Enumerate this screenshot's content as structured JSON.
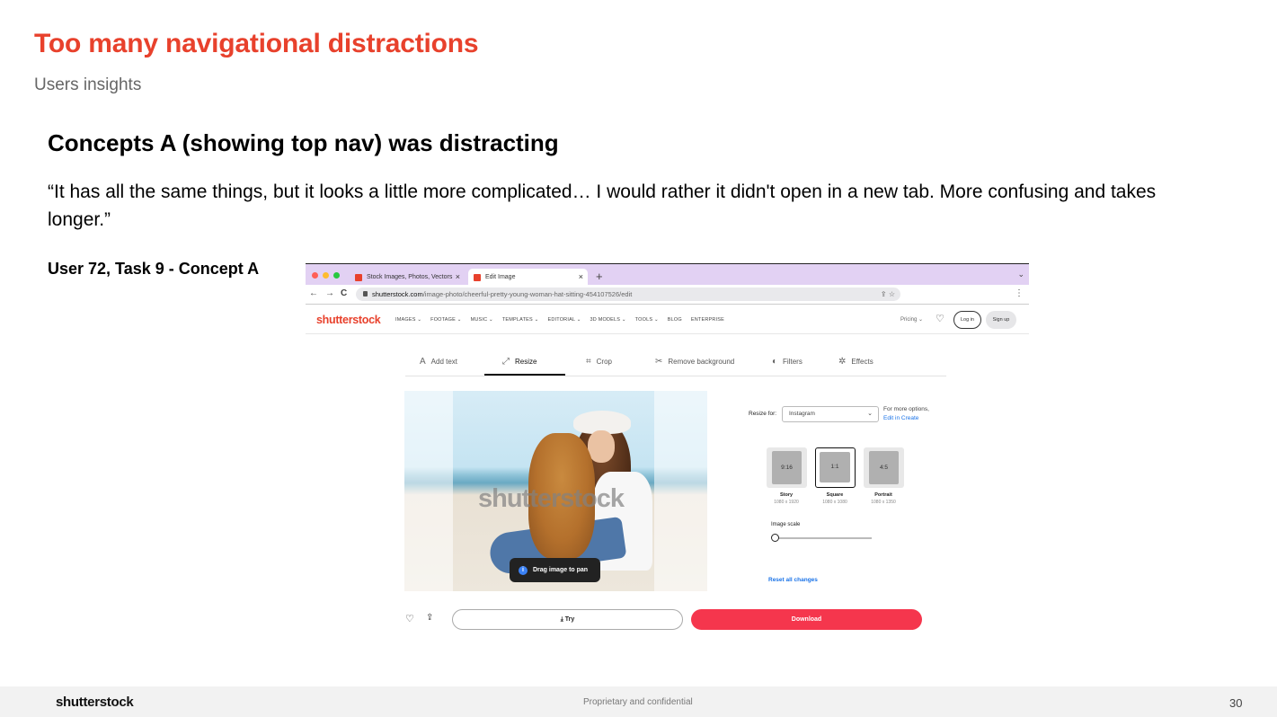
{
  "slide": {
    "title": "Too many navigational distractions",
    "subtitle": "Users insights",
    "heading": "Concepts A (showing top nav) was distracting",
    "quote": "“It has all the same things, but it looks a little more complicated… I would rather it didn't open in a new tab. More confusing and takes longer.”",
    "caption": "User 72, Task 9 - Concept A"
  },
  "browser": {
    "tabs": [
      {
        "label": "Stock Images, Photos, Vectors",
        "close": "×"
      },
      {
        "label": "Edit Image",
        "close": "×"
      }
    ],
    "new_tab": "+",
    "tab_menu": "⌄",
    "nav_back": "←",
    "nav_forward": "→",
    "nav_reload": "C",
    "url_host": "shutterstock.com",
    "url_path": "/image-photo/cheerful-pretty-young-woman-hat-sitting-454107526/edit",
    "url_icons": "⇪  ☆",
    "menu": "⋮"
  },
  "site": {
    "logo": "shutterstock",
    "nav": [
      "IMAGES ⌄",
      "FOOTAGE ⌄",
      "MUSIC ⌄",
      "TEMPLATES ⌄",
      "EDITORIAL ⌄",
      "3D MODELS ⌄",
      "TOOLS ⌄",
      "BLOG",
      "ENTERPRISE"
    ],
    "pricing": "Pricing ⌄",
    "login": "Log in",
    "signup": "Sign up"
  },
  "editor": {
    "tools": [
      {
        "icon": "A",
        "label": "Add text"
      },
      {
        "icon": "⤢",
        "label": "Resize"
      },
      {
        "icon": "⌗",
        "label": "Crop"
      },
      {
        "icon": "✂",
        "label": "Remove background"
      },
      {
        "icon": "◐",
        "label": "Filters"
      },
      {
        "icon": "✲",
        "label": "Effects"
      }
    ],
    "active_tool": "Resize",
    "watermark": "shutterstock",
    "pan_hint": "Drag image to pan",
    "info_icon": "i",
    "resize_for_label": "Resize for:",
    "resize_for_value": "Instagram",
    "select_chevron": "⌄",
    "more_options": "For more options,",
    "more_options_link": "Edit in Create",
    "ratios": [
      {
        "ratio": "9:16",
        "name": "Story",
        "dims": "1080 x 1920"
      },
      {
        "ratio": "1:1",
        "name": "Square",
        "dims": "1080 x 1080"
      },
      {
        "ratio": "4:5",
        "name": "Portrait",
        "dims": "1080 x 1350"
      }
    ],
    "selected_ratio": "1:1",
    "image_scale_label": "Image scale",
    "image_scale_value": 0,
    "reset": "Reset all changes",
    "heart": "♡",
    "share": "⇪",
    "try_label": "⤓  Try",
    "download_label": "Download"
  },
  "footer": {
    "logo": "shutterstock",
    "confidential": "Proprietary and confidential",
    "page": "30"
  },
  "colors": {
    "title_red": "#e8412c",
    "download_red": "#f5364d",
    "link_blue": "#1a73e8",
    "tabbar_purple": "#e2d1f3"
  }
}
